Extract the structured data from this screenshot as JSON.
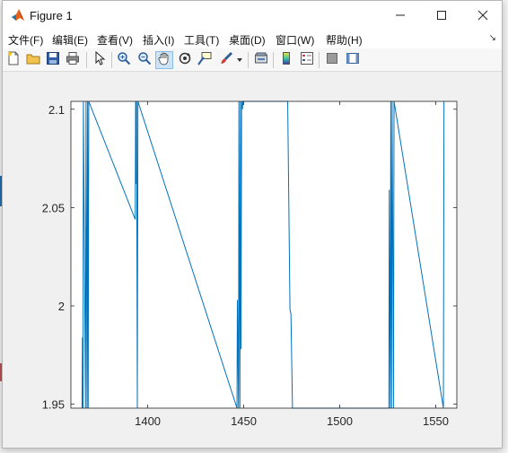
{
  "window": {
    "title": "Figure 1",
    "icon": "matlab-logo-icon",
    "controls": [
      "minimize-icon",
      "maximize-icon",
      "close-icon"
    ]
  },
  "menu": {
    "items": [
      "文件(F)",
      "编辑(E)",
      "查看(V)",
      "插入(I)",
      "工具(T)",
      "桌面(D)",
      "窗口(W)",
      "帮助(H)"
    ],
    "overflow_glyph": "↘"
  },
  "toolbar": {
    "buttons": [
      {
        "icon": "new-figure-icon"
      },
      {
        "icon": "open-file-icon"
      },
      {
        "icon": "save-icon"
      },
      {
        "icon": "print-icon"
      },
      {
        "icon": "pointer-icon"
      },
      {
        "icon": "zoom-in-icon"
      },
      {
        "icon": "zoom-out-icon"
      },
      {
        "icon": "pan-icon",
        "active": true
      },
      {
        "icon": "rotate-3d-icon"
      },
      {
        "icon": "data-cursor-icon"
      },
      {
        "icon": "brush-icon"
      },
      {
        "icon": "link-plot-icon"
      },
      {
        "icon": "colorbar-icon"
      },
      {
        "icon": "legend-icon"
      },
      {
        "icon": "hide-plot-tools-icon"
      },
      {
        "icon": "show-plot-tools-icon"
      }
    ]
  },
  "chart_data": {
    "type": "line",
    "title": "",
    "xlabel": "",
    "ylabel": "",
    "xlim": [
      1360,
      1561
    ],
    "ylim": [
      1.948,
      2.104
    ],
    "x_ticks": [
      1400,
      1450,
      1500,
      1550
    ],
    "x_tick_labels": [
      "1400",
      "1450",
      "1500",
      "1550"
    ],
    "y_ticks": [
      1.95,
      2,
      2.05,
      2.1
    ],
    "y_tick_labels": [
      "1.95",
      "2",
      "2.05",
      "2.1"
    ],
    "grid": false,
    "line_color": "#0072bd",
    "series": [
      {
        "x": [
          1365.8,
          1366.0,
          1366.3,
          1366.5,
          1367.6,
          1367.9,
          1368.4,
          1368.7,
          1369.0,
          1369.3,
          1393.5,
          1393.7,
          1394.0,
          1394.2,
          1394.6,
          1394.9,
          1446.5,
          1446.7,
          1447.3,
          1447.5,
          1448.0,
          1448.3,
          1448.6,
          1448.9,
          1449.3,
          1449.6,
          1472.9,
          1474.1,
          1474.6,
          1475.4,
          1475.7,
          1525.6,
          1525.8,
          1526.3,
          1526.6,
          1527.0,
          1527.3,
          1528.0,
          1528.3,
          1554.0,
          1554.3
        ],
        "y": [
          1.948,
          1.984,
          1.948,
          2.104,
          1.948,
          2.104,
          1.948,
          2.104,
          1.948,
          2.104,
          2.044,
          2.104,
          2.062,
          2.104,
          1.948,
          2.104,
          1.948,
          2.003,
          1.948,
          2.104,
          1.948,
          2.104,
          1.978,
          2.104,
          2.1,
          2.104,
          2.104,
          1.998,
          1.996,
          1.948,
          1.948,
          1.948,
          2.059,
          1.948,
          2.104,
          1.948,
          2.104,
          1.948,
          2.104,
          1.948,
          2.104
        ]
      }
    ]
  }
}
